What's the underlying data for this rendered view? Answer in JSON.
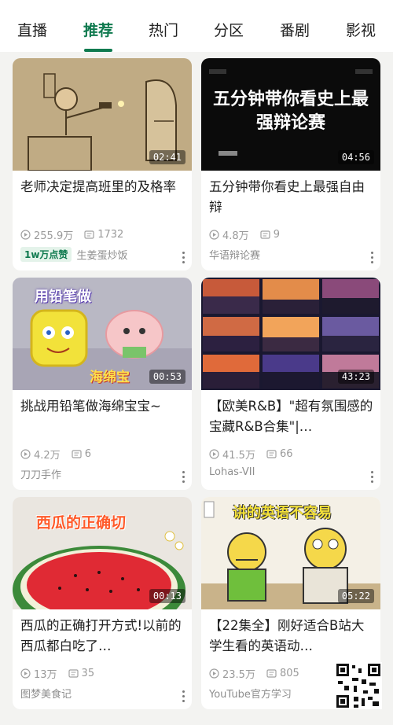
{
  "tabs": [
    {
      "label": "直播"
    },
    {
      "label": "推荐",
      "active": true
    },
    {
      "label": "热门"
    },
    {
      "label": "分区"
    },
    {
      "label": "番剧"
    },
    {
      "label": "影视"
    }
  ],
  "colors": {
    "accent": "#0f7a4f",
    "feed_bg": "#f3f3f1"
  },
  "cards": [
    {
      "duration": "02:41",
      "title": "老师决定提高班里的及格率",
      "views": "255.9万",
      "comments": "1732",
      "badge": "1w万点赞",
      "author": "生姜蛋炒饭"
    },
    {
      "thumb_text": "五分钟带你看史上最强辩论赛",
      "duration": "04:56",
      "title": "五分钟带你看史上最强自由辩",
      "views": "4.8万",
      "comments": "9",
      "author": "华语辩论赛"
    },
    {
      "thumb_text_top": "用铅笔做",
      "thumb_text_bottom": "海绵宝",
      "duration": "00:53",
      "title": "挑战用铅笔做海绵宝宝~",
      "views": "4.2万",
      "comments": "6",
      "author": "刀刀手作"
    },
    {
      "duration": "43:23",
      "title": "【欧美R&B】\"超有氛围感的宝藏R&B合集\"|…",
      "views": "41.5万",
      "comments": "66",
      "author": "Lohas-VII"
    },
    {
      "thumb_text": "西瓜的正确切",
      "duration": "00:13",
      "title": "西瓜的正确打开方式!以前的西瓜都白吃了…",
      "views": "13万",
      "comments": "35",
      "author": "图梦美食记"
    },
    {
      "thumb_text": "讲的英语不容易",
      "duration": "05:22",
      "title": "【22集全】刚好适合B站大学生看的英语动…",
      "views": "23.5万",
      "comments": "805",
      "author": "YouTube官方学习"
    }
  ]
}
